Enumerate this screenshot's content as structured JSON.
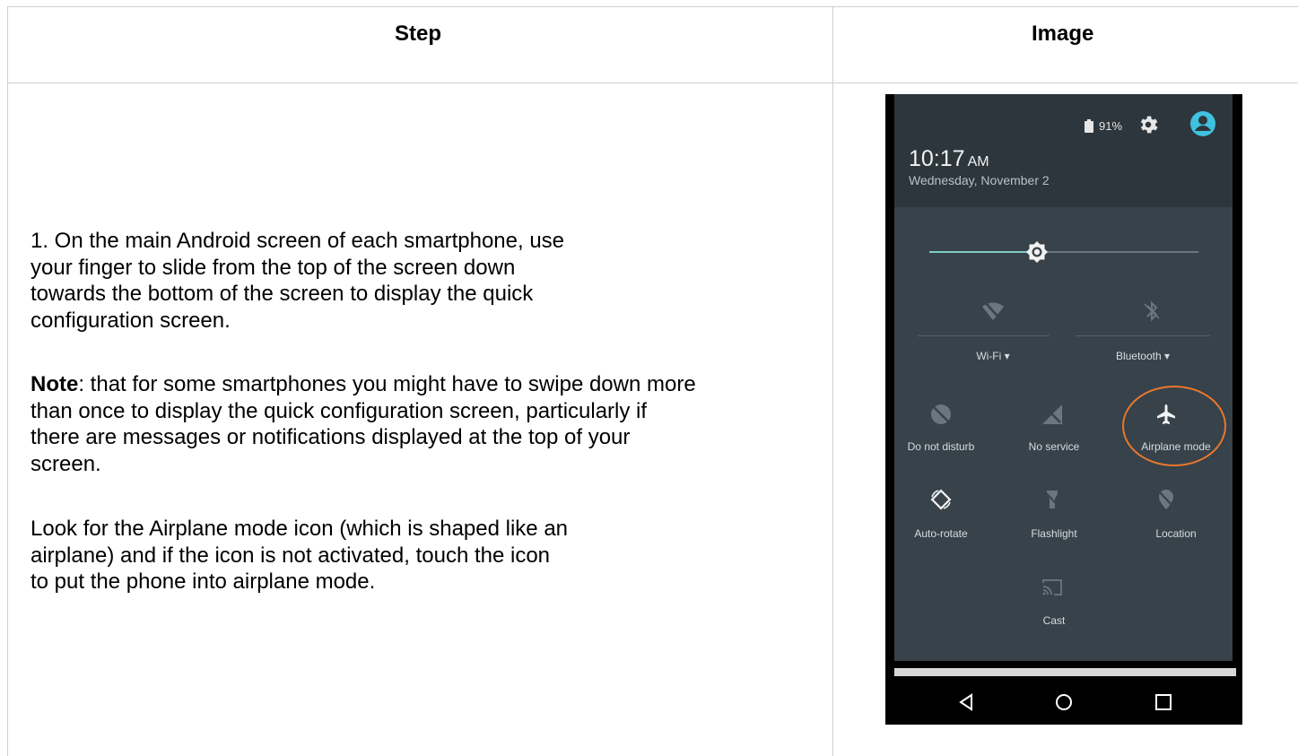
{
  "table": {
    "headers": {
      "step": "Step",
      "image": "Image"
    }
  },
  "step_text": {
    "p1_lines": [
      "1. On the main Android screen of each smartphone, use",
      "your finger to slide from the top of the screen down",
      "towards the bottom of the screen to display the quick",
      "configuration screen."
    ],
    "note_label": "Note",
    "p2_first_rest": ": that for some smartphones you might have to swipe down more",
    "p2_lines": [
      "than once to display the quick configuration screen, particularly if",
      "there are messages or notifications displayed at the top of your",
      "screen."
    ],
    "p3_lines": [
      "Look for the Airplane mode icon (which is shaped like an",
      "airplane) and if the icon is not activated, touch the icon",
      "to put the phone into airplane mode."
    ]
  },
  "phone": {
    "battery_pct": "91%",
    "time": "10:17",
    "ampm": "AM",
    "date": "Wednesday, November 2",
    "brightness_level": 0.39,
    "tiles": {
      "wifi": "Wi-Fi",
      "bluetooth": "Bluetooth",
      "do_not_disturb": "Do not disturb",
      "no_service": "No service",
      "airplane_mode": "Airplane mode",
      "auto_rotate": "Auto-rotate",
      "flashlight": "Flashlight",
      "location": "Location",
      "cast": "Cast"
    },
    "colors": {
      "shade": "#37424a",
      "accent": "#7fcbc4",
      "highlight_circle": "#e8782c",
      "avatar": "#3fc1e0"
    }
  }
}
